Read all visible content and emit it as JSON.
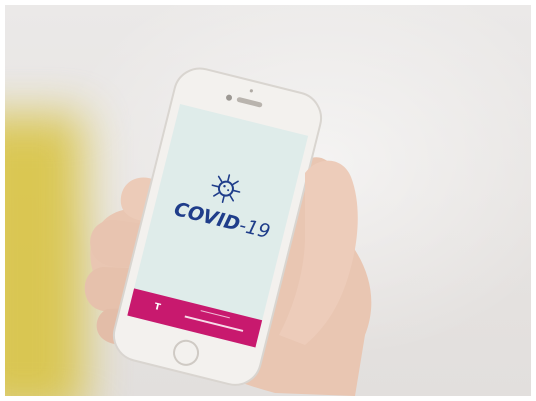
{
  "app": {
    "title_main": "COVID",
    "title_suffix": "-19",
    "footer_brand": "T",
    "footer_text_small": "",
    "footer_text": ""
  },
  "colors": {
    "title": "#1f3d8a",
    "screen": "#dfecea",
    "footer": "#c8196e",
    "phone_body": "#f3f1ee"
  },
  "icons": [
    "virus-icon",
    "telekom-logo-icon"
  ]
}
